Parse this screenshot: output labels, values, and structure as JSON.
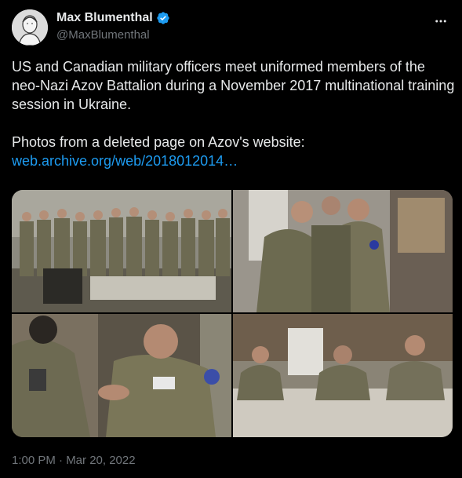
{
  "author": {
    "display_name": "Max Blumenthal",
    "handle": "@MaxBlumenthal",
    "verified": true,
    "verified_color": "#1d9bf0"
  },
  "tweet": {
    "text": "US and Canadian military officers meet uniformed members of the neo-Nazi Azov Battalion during a November 2017 multinational training session in Ukraine.\n\nPhotos from a deleted page on Azov's website:",
    "link": "web.archive.org/web/2018012014…",
    "link_color": "#1d9bf0"
  },
  "media": {
    "photos": [
      {
        "icon": "group-photo"
      },
      {
        "icon": "officers-conversation-photo"
      },
      {
        "icon": "handshake-photo"
      },
      {
        "icon": "table-meeting-photo"
      }
    ]
  },
  "timestamp": "1:00 PM · Mar 20, 2022",
  "colors": {
    "background": "#000000",
    "text_primary": "#e7e9ea",
    "text_secondary": "#71767b",
    "accent": "#1d9bf0"
  }
}
